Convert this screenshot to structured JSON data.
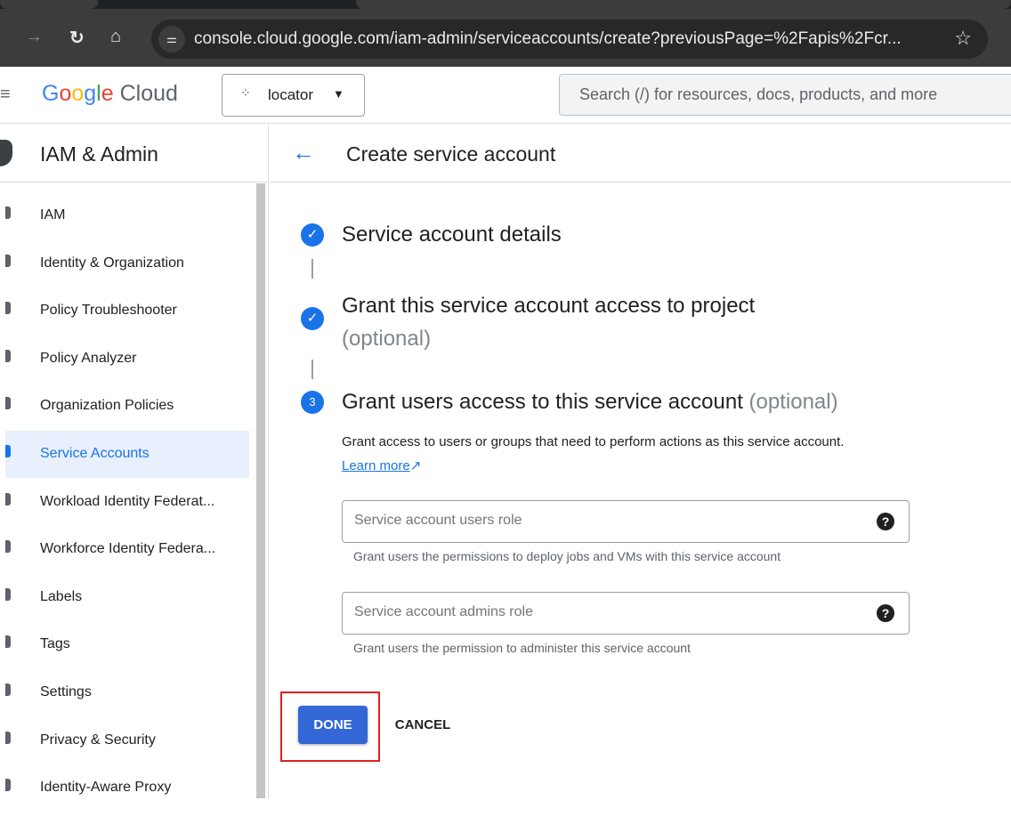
{
  "browser": {
    "url": "console.cloud.google.com/iam-admin/serviceaccounts/create?previousPage=%2Fapis%2Fcr...",
    "icons": [
      "forward-icon",
      "reload-icon",
      "home-icon",
      "site-settings-icon",
      "bookmark-star-icon"
    ]
  },
  "header": {
    "logo_google": "Google",
    "logo_cloud": "Cloud",
    "project": "locator",
    "search_placeholder": "Search (/) for resources, docs, products, and more"
  },
  "sidebar": {
    "title": "IAM & Admin",
    "items": [
      {
        "label": "IAM"
      },
      {
        "label": "Identity & Organization"
      },
      {
        "label": "Policy Troubleshooter"
      },
      {
        "label": "Policy Analyzer"
      },
      {
        "label": "Organization Policies"
      },
      {
        "label": "Service Accounts",
        "active": true
      },
      {
        "label": "Workload Identity Federat..."
      },
      {
        "label": "Workforce Identity Federa..."
      },
      {
        "label": "Labels"
      },
      {
        "label": "Tags"
      },
      {
        "label": "Settings"
      },
      {
        "label": "Privacy & Security"
      },
      {
        "label": "Identity-Aware Proxy"
      }
    ]
  },
  "main": {
    "title": "Create service account",
    "steps": [
      {
        "title": "Service account details",
        "optional": "",
        "status": "done"
      },
      {
        "title": "Grant this service account access to project",
        "optional": "(optional)",
        "status": "done"
      },
      {
        "number": "3",
        "title": "Grant users access to this service account",
        "optional": "(optional)",
        "status": "current"
      }
    ],
    "description": "Grant access to users or groups that need to perform actions as this service account.",
    "learn_more": "Learn more",
    "fields": [
      {
        "placeholder": "Service account users role",
        "hint": "Grant users the permissions to deploy jobs and VMs with this service account"
      },
      {
        "placeholder": "Service account admins role",
        "hint": "Grant users the permission to administer this service account"
      }
    ],
    "done_label": "DONE",
    "cancel_label": "CANCEL"
  },
  "colors": {
    "accent": "#1a73e8",
    "highlight_box": "#e02020",
    "done_button": "#3367d6"
  }
}
